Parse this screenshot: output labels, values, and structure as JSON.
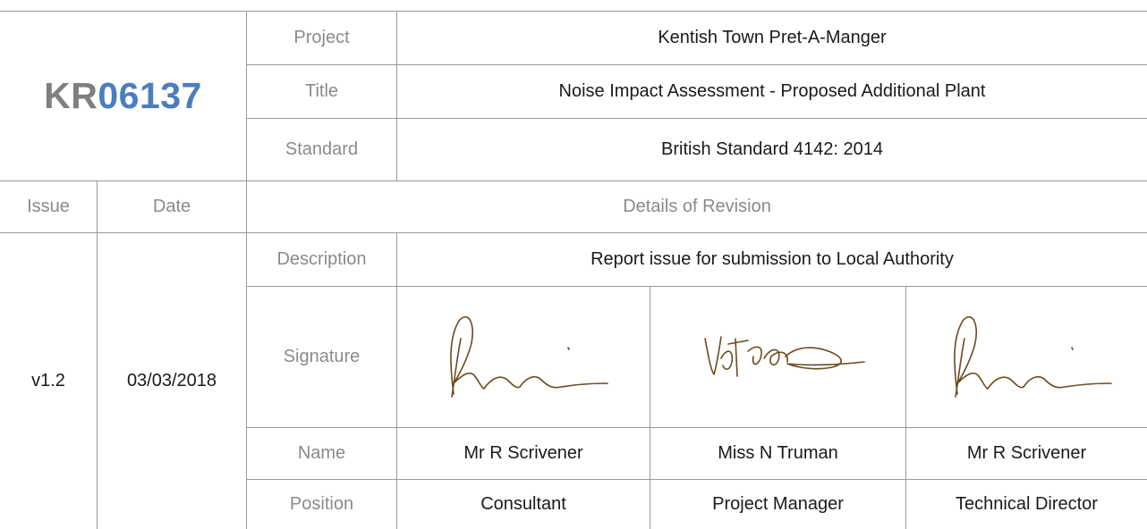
{
  "reference": {
    "prefix": "KR",
    "number": "06137",
    "prefix_color": "#7f7f7f",
    "number_color": "#4a7ebf"
  },
  "header": [
    {
      "label": "Project",
      "value": "Kentish Town Pret-A-Manger"
    },
    {
      "label": "Title",
      "value": "Noise Impact Assessment - Proposed Additional Plant"
    },
    {
      "label": "Standard",
      "value": "British Standard 4142: 2014"
    }
  ],
  "revision_header": {
    "issue": "Issue",
    "date": "Date",
    "details": "Details of Revision"
  },
  "revision": {
    "issue": "v1.2",
    "date": "03/03/2018",
    "description_label": "Description",
    "description": "Report issue for submission to Local Authority",
    "signature_label": "Signature",
    "name_label": "Name",
    "position_label": "Position",
    "signatories": [
      {
        "name": "Mr R Scrivener",
        "position": "Consultant",
        "signature_icon": "signature-scrivener"
      },
      {
        "name": "Miss N Truman",
        "position": "Project Manager",
        "signature_icon": "signature-truman"
      },
      {
        "name": "Mr R Scrivener",
        "position": "Technical Director",
        "signature_icon": "signature-scrivener"
      }
    ]
  }
}
